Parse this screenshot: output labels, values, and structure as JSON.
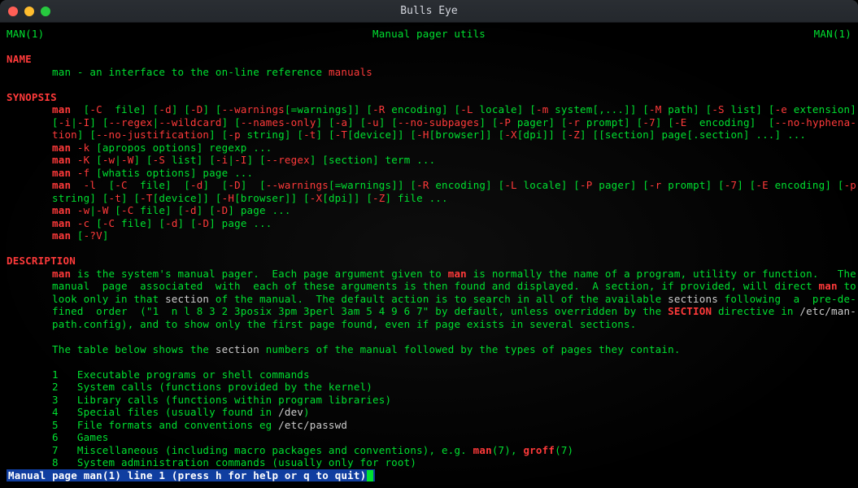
{
  "window": {
    "title": "Bulls Eye"
  },
  "header": {
    "left": "MAN(1)",
    "center": "Manual pager utils",
    "right": "MAN(1)"
  },
  "sections": {
    "name": "NAME",
    "synopsis": "SYNOPSIS",
    "description": "DESCRIPTION"
  },
  "name_line": {
    "pre": "man - an interface to the on-line reference ",
    "hl": "manuals"
  },
  "syn": {
    "line1": {
      "pre": "man",
      "rest": "  [-C  file] [-d] [-D] [--warnings[=warnings]] [-R encoding] [-L locale] [-m system[,...]] [-M path] [-S list] [-e extension]"
    },
    "line2": "[-i|-I] [--regex|--wildcard] [--names-only] [-a] [-u] [--no-subpages] [-P pager] [-r prompt] [-7] [-E  encoding]  [--no-hyphena-",
    "line3": "tion] [--no-justification] [-p string] [-t] [-T[device]] [-H[browser]] [-X[dpi]] [-Z] [[section] page[.section] ...] ...",
    "line4": "man -k [apropos options] regexp ...",
    "line5": "man -K [-w|-W] [-S list] [-i|-I] [--regex] [section] term ...",
    "line6": "man -f [whatis options] page ...",
    "line7": "man  -l  [-C  file]  [-d]  [-D]  [--warnings[=warnings]] [-R encoding] [-L locale] [-P pager] [-r prompt] [-7] [-E encoding] [-p",
    "line8": "string] [-t] [-T[device]] [-H[browser]] [-X[dpi]] [-Z] file ...",
    "line9": "man -w|-W [-C file] [-d] [-D] page ...",
    "line10": "man -c [-C file] [-d] [-D] page ...",
    "line11": "man [-?V]"
  },
  "desc": {
    "p1": "man is the system's manual pager.  Each page argument given to man is normally the name of a program, utility or function.   The",
    "p2": "manual  page  associated  with  each of these arguments is then found and displayed.  A section, if provided, will direct man to",
    "p3a": "look only in that ",
    "p3b": "section",
    "p3c": " of the manual.  The default action is to search in all of the available ",
    "p3d": "sections",
    "p3e": " following  a  pre-de-",
    "p4a": "fined  order  (\"1  n l 8 3 2 3posix 3pm 3perl 3am 5 4 9 6 7\" by default, unless overridden by the ",
    "p4b": "SECTION",
    "p4c": " directive in ",
    "p4d": "/etc/man-",
    "p5": "path.config), and to show only the first page found, even if page exists in several sections.",
    "p6a": "The table below shows the ",
    "p6b": "section",
    "p6c": " numbers of the manual followed by the types of pages they contain."
  },
  "table": [
    {
      "n": "1",
      "t": "Executable programs or shell commands"
    },
    {
      "n": "2",
      "t": "System calls (functions provided by the kernel)"
    },
    {
      "n": "3",
      "t": "Library calls (functions within program libraries)"
    },
    {
      "n": "4",
      "t": "Special files (usually found in /dev)"
    },
    {
      "n": "5",
      "t": "File formats and conventions eg /etc/passwd"
    },
    {
      "n": "6",
      "t": "Games"
    },
    {
      "n": "7",
      "t": "Miscellaneous (including macro packages and conventions), e.g. man(7), groff(7)"
    },
    {
      "n": "8",
      "t": "System administration commands (usually only for root)"
    }
  ],
  "status": " Manual page man(1) line 1 (press h for help or q to quit)"
}
